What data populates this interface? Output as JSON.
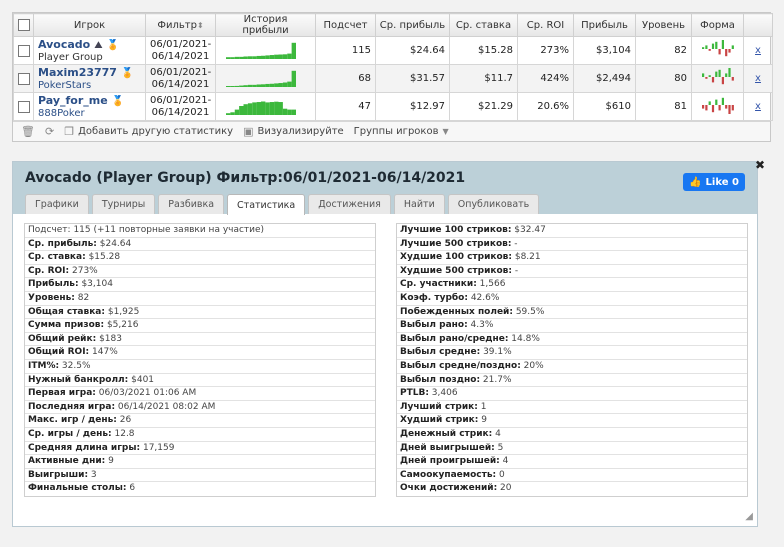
{
  "table": {
    "headers": [
      "Игрок",
      "Фильтр",
      "История прибыли",
      "Подсчет",
      "Ср. прибыль",
      "Ср. ставка",
      "Ср. ROI",
      "Прибыль",
      "Уровень",
      "Форма"
    ],
    "sort_icon": "sort-updown-icon",
    "rows": [
      {
        "name": "Avocado",
        "group": "Player Group",
        "filter_from": "06/01/2021-",
        "filter_to": "06/14/2021",
        "count": "115",
        "avg_profit": "$24.64",
        "avg_stake": "$15.28",
        "avg_roi": "273%",
        "profit": "$3,104",
        "level": "82",
        "del": "x",
        "history": [
          0.1,
          0.1,
          0.12,
          0.12,
          0.14,
          0.15,
          0.15,
          0.17,
          0.18,
          0.2,
          0.22,
          0.24,
          0.25,
          0.26,
          0.3,
          0.9
        ],
        "form": [
          1,
          2,
          -1,
          3,
          4,
          -3,
          5,
          -4,
          -2,
          2
        ]
      },
      {
        "name": "Maxim23777",
        "group": "PokerStars",
        "filter_from": "06/01/2021-",
        "filter_to": "06/14/2021",
        "count": "68",
        "avg_profit": "$31.57",
        "avg_stake": "$11.7",
        "avg_roi": "424%",
        "profit": "$2,494",
        "level": "80",
        "del": "x",
        "history": [
          0.05,
          0.05,
          0.06,
          0.08,
          0.1,
          0.12,
          0.12,
          0.14,
          0.15,
          0.17,
          0.18,
          0.2,
          0.22,
          0.25,
          0.3,
          0.9
        ],
        "form": [
          2,
          -1,
          1,
          -3,
          3,
          4,
          -4,
          2,
          5,
          -2
        ]
      },
      {
        "name": "Pay_for_me",
        "group": "888Poker",
        "filter_from": "06/01/2021-",
        "filter_to": "06/14/2021",
        "count": "47",
        "avg_profit": "$12.97",
        "avg_stake": "$21.29",
        "avg_roi": "20.6%",
        "profit": "$610",
        "level": "81",
        "del": "x",
        "history": [
          0.1,
          0.15,
          0.3,
          0.5,
          0.6,
          0.65,
          0.7,
          0.72,
          0.75,
          0.7,
          0.72,
          0.74,
          0.72,
          0.35,
          0.3,
          0.3
        ],
        "form": [
          -2,
          -3,
          2,
          -4,
          3,
          -3,
          4,
          -2,
          -5,
          -3
        ]
      }
    ]
  },
  "toolbar": {
    "add_stats": "Добавить другую статистику",
    "visualize": "Визуализируйте",
    "groups": "Группы игроков"
  },
  "panel": {
    "title": "Avocado (Player Group) Фильтр:06/01/2021-06/14/2021",
    "like_label": "Like 0",
    "tabs": [
      "Графики",
      "Турниры",
      "Разбивка",
      "Статистика",
      "Достижения",
      "Найти",
      "Опубликовать"
    ],
    "active_tab": 3
  },
  "stats_left": [
    {
      "label": "Подсчет:",
      "value": " 115 (+11 повторные заявки на участие)",
      "plain": true
    },
    {
      "label": "Ср. прибыль:",
      "value": " $24.64"
    },
    {
      "label": "Ср. ставка:",
      "value": " $15.28"
    },
    {
      "label": "Ср. ROI:",
      "value": " 273%"
    },
    {
      "label": "Прибыль:",
      "value": " $3,104"
    },
    {
      "label": "Уровень:",
      "value": " 82"
    },
    {
      "label": "Общая ставка:",
      "value": " $1,925"
    },
    {
      "label": "Сумма призов:",
      "value": " $5,216"
    },
    {
      "label": "Общий рейк:",
      "value": " $183"
    },
    {
      "label": "Общий ROI:",
      "value": " 147%"
    },
    {
      "label": "ITM%:",
      "value": " 32.5%"
    },
    {
      "label": "Нужный банкролл:",
      "value": " $401"
    },
    {
      "label": "Первая игра:",
      "value": " 06/03/2021 01:06 AM"
    },
    {
      "label": "Последняя игра:",
      "value": " 06/14/2021 08:02 AM"
    },
    {
      "label": "Макс. игр / день:",
      "value": " 26"
    },
    {
      "label": "Ср. игры / день:",
      "value": " 12.8"
    },
    {
      "label": "Средняя длина игры:",
      "value": " 17,159"
    },
    {
      "label": "Активные дни:",
      "value": " 9"
    },
    {
      "label": "Выигрыши:",
      "value": " 3"
    },
    {
      "label": "Финальные столы:",
      "value": " 6"
    }
  ],
  "stats_right": [
    {
      "label": "Лучшие 100 стриков:",
      "value": " $32.47"
    },
    {
      "label": "Лучшие 500 стриков:",
      "value": " -"
    },
    {
      "label": "Худшие 100 стриков:",
      "value": " $8.21"
    },
    {
      "label": "Худшие 500 стриков:",
      "value": " -"
    },
    {
      "label": "Ср. участники:",
      "value": " 1,566"
    },
    {
      "label": "Коэф. турбо:",
      "value": " 42.6%"
    },
    {
      "label": "Побежденных полей:",
      "value": " 59.5%"
    },
    {
      "label": "Выбыл рано:",
      "value": " 4.3%"
    },
    {
      "label": "Выбыл рано/средне:",
      "value": " 14.8%"
    },
    {
      "label": "Выбыл средне:",
      "value": " 39.1%"
    },
    {
      "label": "Выбыл средне/поздно:",
      "value": " 20%"
    },
    {
      "label": "Выбыл поздно:",
      "value": " 21.7%"
    },
    {
      "label": "PTLB:",
      "value": " 3,406"
    },
    {
      "label": "Лучший стрик:",
      "value": " 1"
    },
    {
      "label": "Худший стрик:",
      "value": " 9"
    },
    {
      "label": "Денежный стрик:",
      "value": " 4"
    },
    {
      "label": "Дней выигрышей:",
      "value": " 5"
    },
    {
      "label": "Дней проигрышей:",
      "value": " 4"
    },
    {
      "label": "Самоокупаемость:",
      "value": " 0"
    },
    {
      "label": "Очки достижений:",
      "value": " 20"
    }
  ],
  "colors": {
    "accent": "#2b4f87",
    "spark": "#3cb83c",
    "form_up": "#3cb83c",
    "form_down": "#c94444",
    "header_bg": "#bcd0d8",
    "like": "#1877f2"
  }
}
